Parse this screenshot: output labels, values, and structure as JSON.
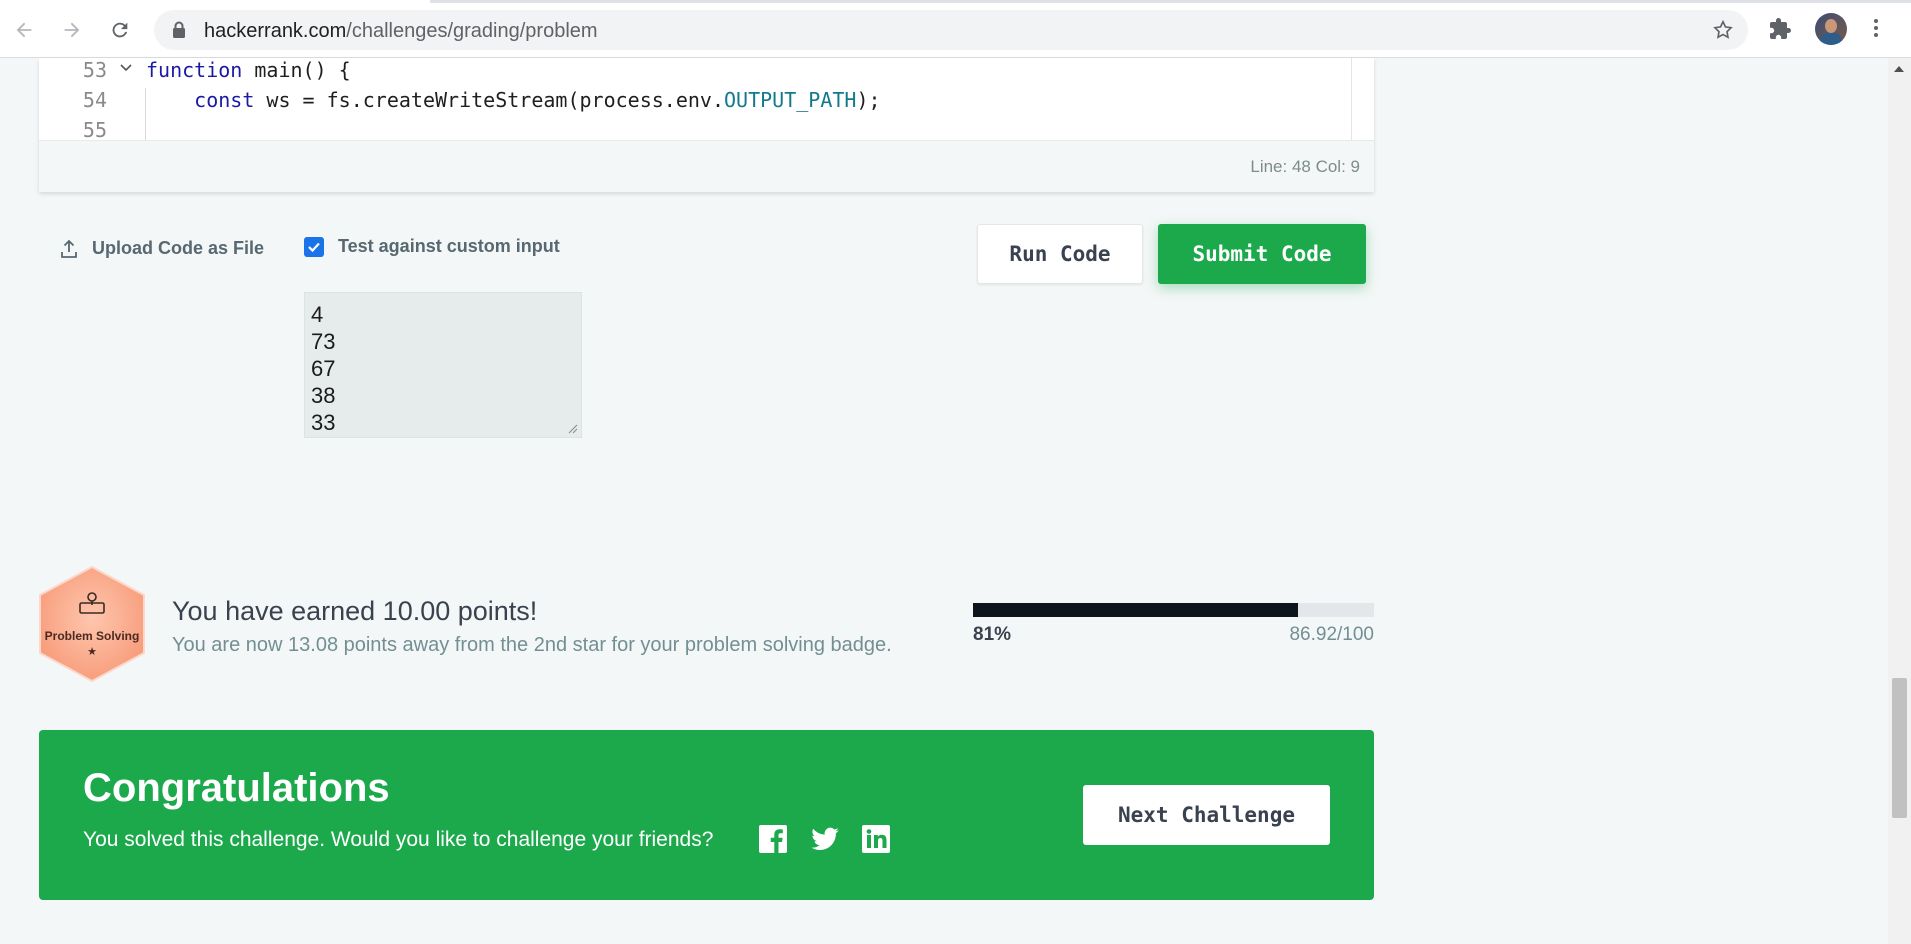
{
  "browser": {
    "url_domain": "hackerrank.com",
    "url_path": "/challenges/grading/problem"
  },
  "editor": {
    "lines": [
      {
        "number": "53",
        "keyword": "function",
        "rest": " main() {"
      },
      {
        "number": "54",
        "indent": "    ",
        "keyword": "const",
        "rest_before": " ws = fs.createWriteStream(process.env.",
        "constant": "OUTPUT_PATH",
        "rest_after": ");"
      },
      {
        "number": "55"
      }
    ],
    "cursor_status": "Line: 48 Col: 9"
  },
  "controls": {
    "upload_label": "Upload Code as File",
    "custom_input_label": "Test against custom input",
    "custom_input_checked": true,
    "custom_input_values": [
      "4",
      "73",
      "67",
      "38",
      "33"
    ],
    "run_label": "Run Code",
    "submit_label": "Submit Code"
  },
  "badge": {
    "name": "Problem Solving",
    "stars": "★"
  },
  "points": {
    "title": "You have earned 10.00 points!",
    "subtitle": "You are now 13.08 points away from the 2nd star for your problem solving badge.",
    "progress_percent": 81,
    "progress_label": "81%",
    "score_label": "86.92/100"
  },
  "congrats": {
    "title": "Congratulations",
    "message": "You solved this challenge. Would you like to challenge your friends?",
    "next_label": "Next Challenge",
    "social_icons": [
      "facebook-icon",
      "twitter-icon",
      "linkedin-icon"
    ]
  },
  "colors": {
    "accent_green": "#1ba94c",
    "progress_fill": "#0e141e",
    "badge": "#f7a98a"
  }
}
